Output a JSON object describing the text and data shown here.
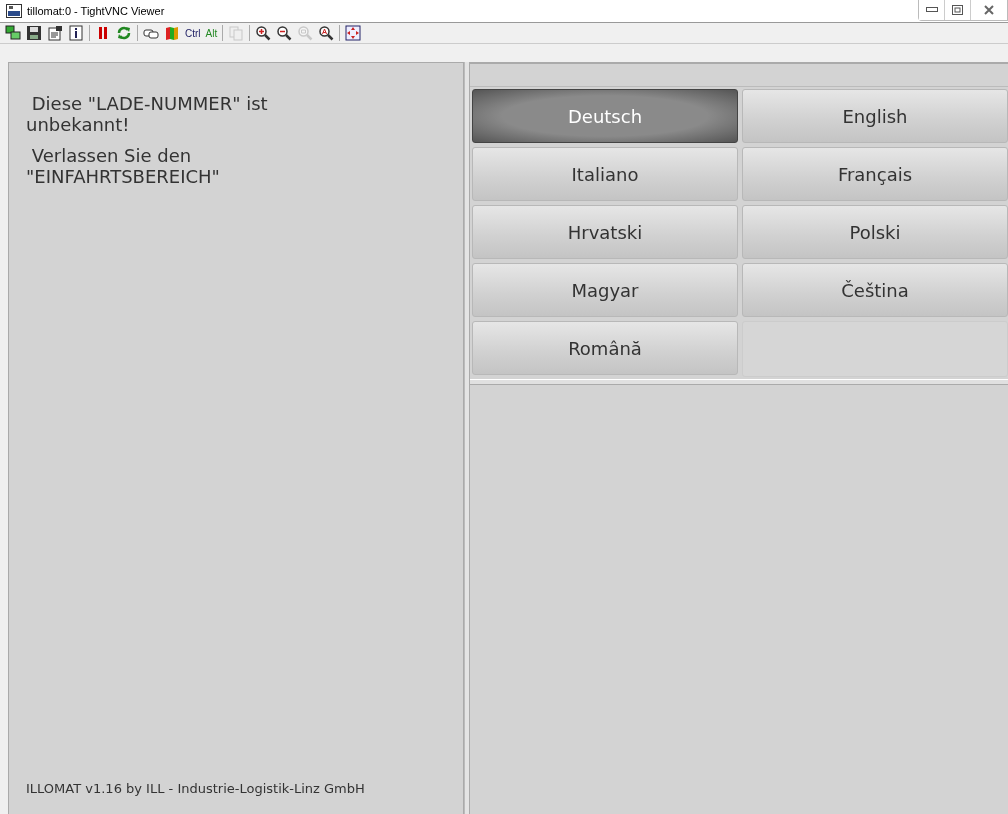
{
  "window": {
    "title": "tillomat:0 - TightVNC Viewer"
  },
  "toolbar": [
    {
      "kind": "connection",
      "disabled": false
    },
    {
      "kind": "save",
      "disabled": false
    },
    {
      "kind": "options",
      "disabled": false
    },
    {
      "kind": "info",
      "disabled": false
    },
    {
      "kind": "separator"
    },
    {
      "kind": "pause",
      "disabled": false
    },
    {
      "kind": "refresh",
      "disabled": false
    },
    {
      "kind": "separator"
    },
    {
      "kind": "keys",
      "disabled": false
    },
    {
      "kind": "flag",
      "disabled": false
    },
    {
      "kind": "ctrl",
      "label": "Ctrl",
      "disabled": false
    },
    {
      "kind": "alt",
      "label": "Alt",
      "disabled": false
    },
    {
      "kind": "separator"
    },
    {
      "kind": "copy",
      "disabled": true
    },
    {
      "kind": "separator"
    },
    {
      "kind": "zoomin",
      "disabled": false
    },
    {
      "kind": "zoomout",
      "disabled": false
    },
    {
      "kind": "zoomfit",
      "disabled": true
    },
    {
      "kind": "zoomauto",
      "disabled": false
    },
    {
      "kind": "separator"
    },
    {
      "kind": "fullscreen",
      "disabled": false
    }
  ],
  "message": {
    "paragraphs": [
      " Diese \"LADE-NUMMER\" ist\nunbekannt!",
      " Verlassen Sie den\n\"EINFAHRTSBEREICH\""
    ]
  },
  "footer": "ILLOMAT v1.16 by ILL - Industrie-Logistik-Linz GmbH",
  "languages": [
    {
      "label": "Deutsch",
      "selected": true
    },
    {
      "label": "English",
      "selected": false
    },
    {
      "label": "Italiano",
      "selected": false
    },
    {
      "label": "Français",
      "selected": false
    },
    {
      "label": "Hrvatski",
      "selected": false
    },
    {
      "label": "Polski",
      "selected": false
    },
    {
      "label": "Magyar",
      "selected": false
    },
    {
      "label": "Čeština",
      "selected": false
    },
    {
      "label": "Română",
      "selected": false
    }
  ]
}
